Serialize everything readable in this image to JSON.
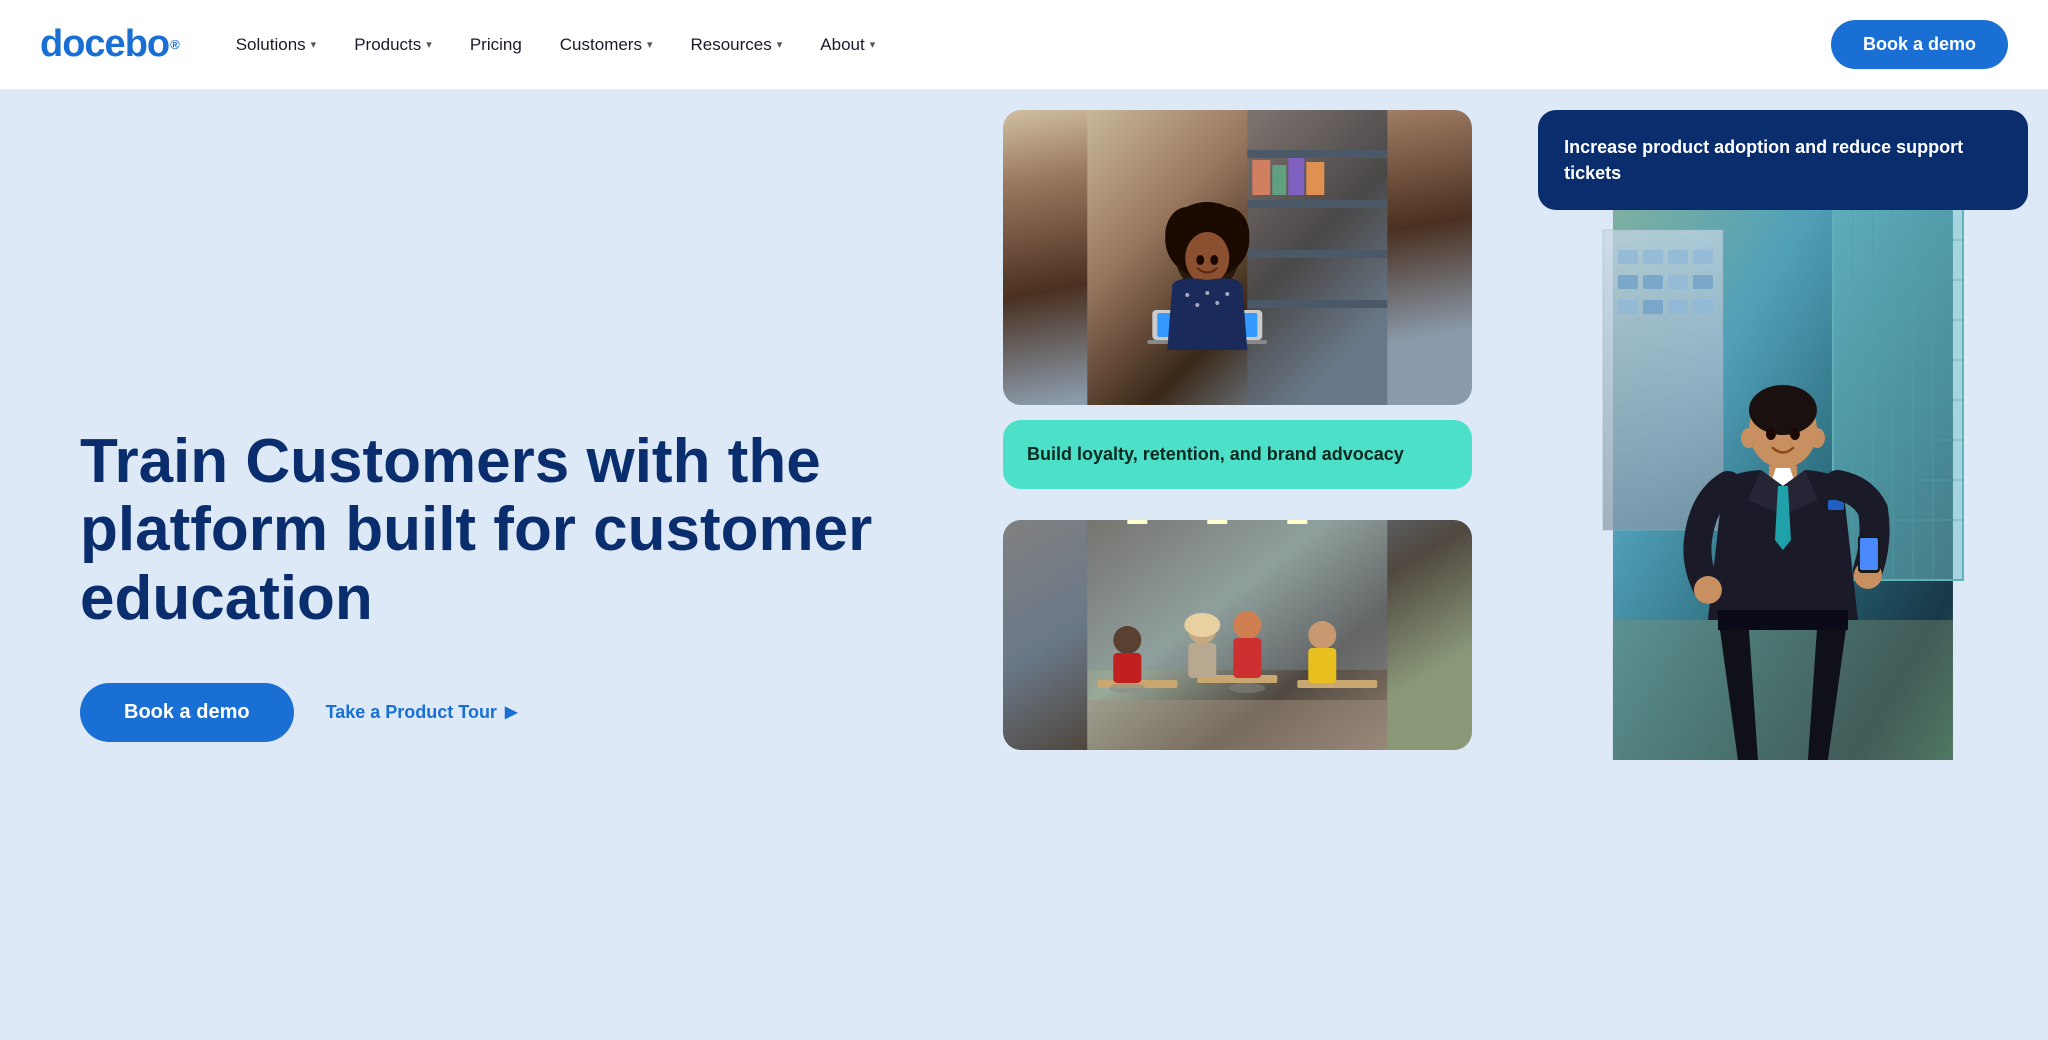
{
  "brand": {
    "name": "docebo",
    "logo_symbol": "®"
  },
  "nav": {
    "links": [
      {
        "label": "Solutions",
        "has_dropdown": true
      },
      {
        "label": "Products",
        "has_dropdown": true
      },
      {
        "label": "Pricing",
        "has_dropdown": false
      },
      {
        "label": "Customers",
        "has_dropdown": true
      },
      {
        "label": "Resources",
        "has_dropdown": true
      },
      {
        "label": "About",
        "has_dropdown": true
      }
    ],
    "cta_label": "Book a demo"
  },
  "hero": {
    "heading": "Train Customers with the platform built for customer education",
    "cta_primary": "Book a demo",
    "cta_secondary": "Take a Product Tour",
    "card_blue_text": "Increase product adoption and reduce support tickets",
    "card_teal_text": "Build loyalty, retention, and brand advocacy"
  }
}
